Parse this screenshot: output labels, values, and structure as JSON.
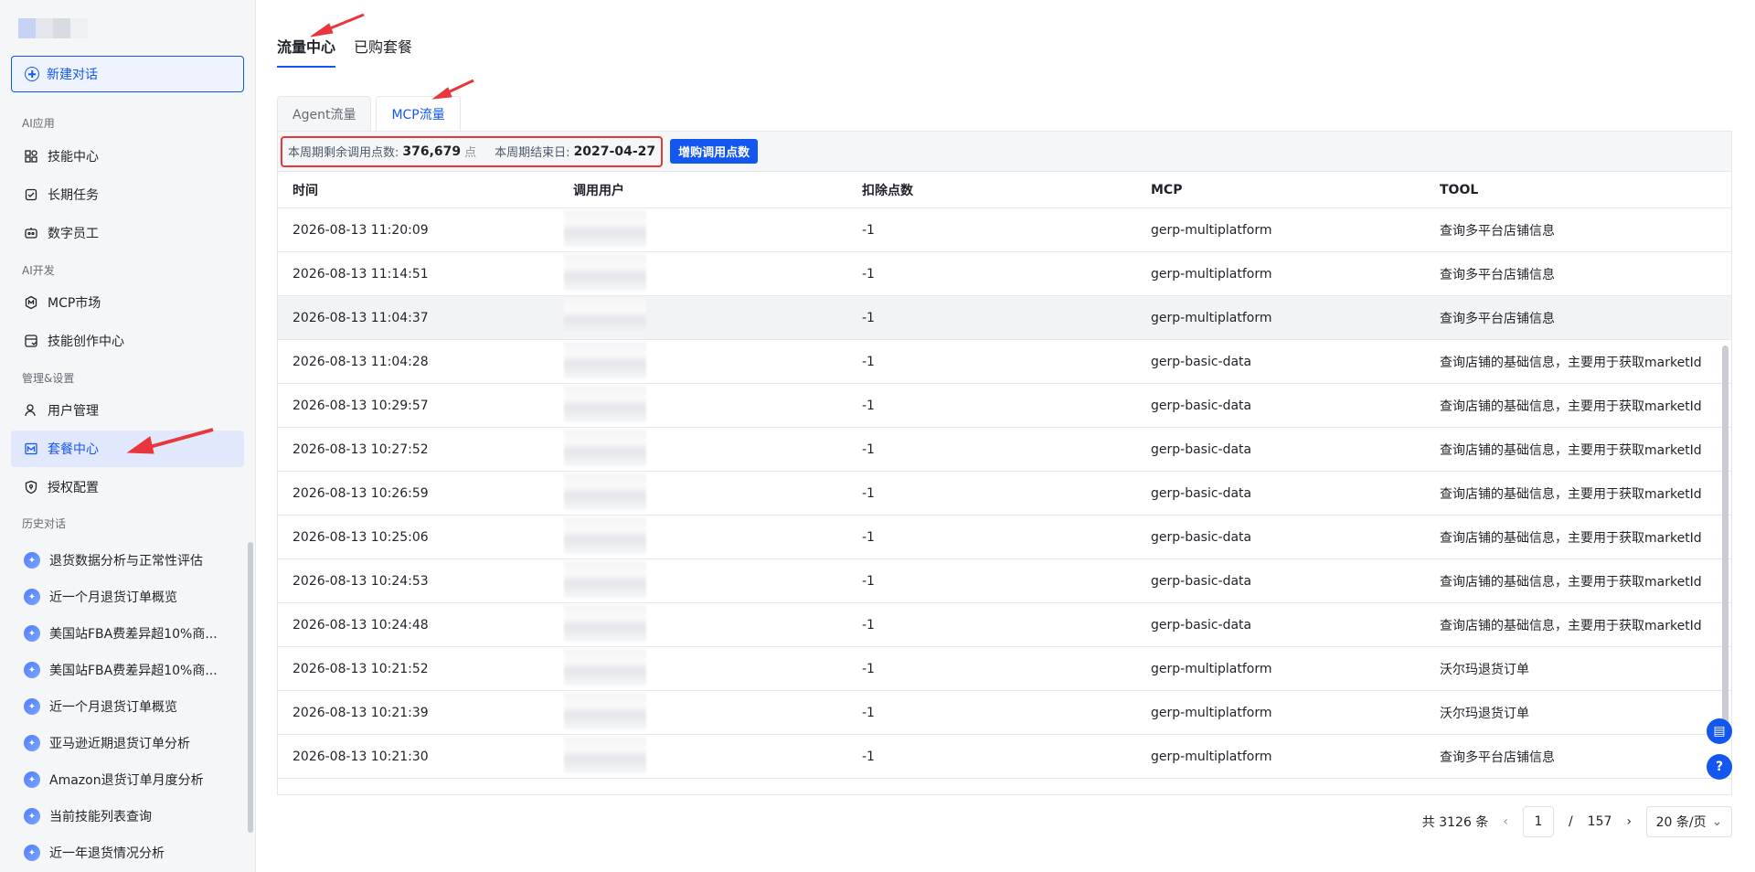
{
  "sidebar": {
    "new_chat_label": "新建对话",
    "section_ai_apps": "AI应用",
    "section_ai_dev": "AI开发",
    "section_manage": "管理&设置",
    "section_history": "历史对话",
    "nav": [
      {
        "label": "技能中心",
        "icon": "apps-icon"
      },
      {
        "label": "长期任务",
        "icon": "task-icon"
      },
      {
        "label": "数字员工",
        "icon": "robot-icon"
      },
      {
        "label": "MCP市场",
        "icon": "mcp-icon"
      },
      {
        "label": "技能创作中心",
        "icon": "create-icon"
      },
      {
        "label": "用户管理",
        "icon": "user-icon"
      },
      {
        "label": "套餐中心",
        "icon": "crown-icon"
      },
      {
        "label": "授权配置",
        "icon": "shield-icon"
      }
    ],
    "history": [
      "退货数据分析与正常性评估",
      "近一个月退货订单概览",
      "美国站FBA费差异超10%商...",
      "美国站FBA费差异超10%商...",
      "近一个月退货订单概览",
      "亚马逊近期退货订单分析",
      "Amazon退货订单月度分析",
      "当前技能列表查询",
      "近一年退货情况分析"
    ]
  },
  "tabs": {
    "top": [
      "流量中心",
      "已购套餐"
    ],
    "sub": [
      "Agent流量",
      "MCP流量"
    ]
  },
  "info": {
    "remaining_label": "本周期剩余调用点数:",
    "remaining_value": "376,679",
    "remaining_unit": "点",
    "end_label": "本周期结束日:",
    "end_value": "2027-04-27",
    "buy_button": "增购调用点数"
  },
  "table": {
    "headers": [
      "时间",
      "调用用户",
      "扣除点数",
      "MCP",
      "TOOL"
    ],
    "rows": [
      {
        "time": "2026-08-13 11:20:09",
        "points": "-1",
        "mcp": "gerp-multiplatform",
        "tool": "查询多平台店铺信息"
      },
      {
        "time": "2026-08-13 11:14:51",
        "points": "-1",
        "mcp": "gerp-multiplatform",
        "tool": "查询多平台店铺信息"
      },
      {
        "time": "2026-08-13 11:04:37",
        "points": "-1",
        "mcp": "gerp-multiplatform",
        "tool": "查询多平台店铺信息"
      },
      {
        "time": "2026-08-13 11:04:28",
        "points": "-1",
        "mcp": "gerp-basic-data",
        "tool": "查询店铺的基础信息，主要用于获取marketId"
      },
      {
        "time": "2026-08-13 10:29:57",
        "points": "-1",
        "mcp": "gerp-basic-data",
        "tool": "查询店铺的基础信息，主要用于获取marketId"
      },
      {
        "time": "2026-08-13 10:27:52",
        "points": "-1",
        "mcp": "gerp-basic-data",
        "tool": "查询店铺的基础信息，主要用于获取marketId"
      },
      {
        "time": "2026-08-13 10:26:59",
        "points": "-1",
        "mcp": "gerp-basic-data",
        "tool": "查询店铺的基础信息，主要用于获取marketId"
      },
      {
        "time": "2026-08-13 10:25:06",
        "points": "-1",
        "mcp": "gerp-basic-data",
        "tool": "查询店铺的基础信息，主要用于获取marketId"
      },
      {
        "time": "2026-08-13 10:24:53",
        "points": "-1",
        "mcp": "gerp-basic-data",
        "tool": "查询店铺的基础信息，主要用于获取marketId"
      },
      {
        "time": "2026-08-13 10:24:48",
        "points": "-1",
        "mcp": "gerp-basic-data",
        "tool": "查询店铺的基础信息，主要用于获取marketId"
      },
      {
        "time": "2026-08-13 10:21:52",
        "points": "-1",
        "mcp": "gerp-multiplatform",
        "tool": "沃尔玛退货订单"
      },
      {
        "time": "2026-08-13 10:21:39",
        "points": "-1",
        "mcp": "gerp-multiplatform",
        "tool": "沃尔玛退货订单"
      },
      {
        "time": "2026-08-13 10:21:30",
        "points": "-1",
        "mcp": "gerp-multiplatform",
        "tool": "查询多平台店铺信息"
      }
    ]
  },
  "pagination": {
    "total": "共 3126 条",
    "current": "1",
    "separator": "/",
    "pages": "157",
    "page_size": "20 条/页"
  },
  "colors": {
    "accent": "#1456f0",
    "annotation": "#e8363d"
  }
}
